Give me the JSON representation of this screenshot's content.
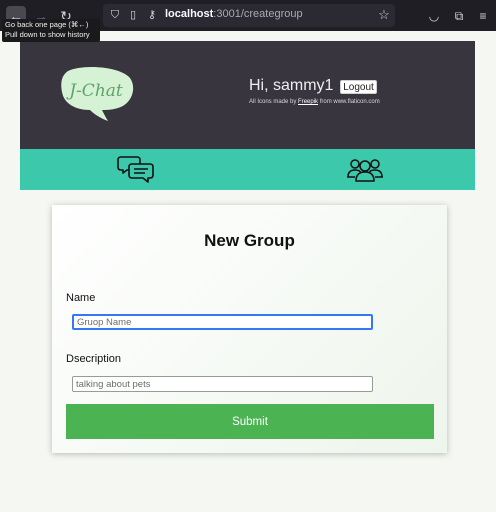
{
  "browser": {
    "url_host": "localhost",
    "url_path": ":3001/creategroup",
    "tooltip_line1": "Go back one page (⌘←)",
    "tooltip_line2": "Pull down to show history"
  },
  "header": {
    "logo_text": "J-Chat",
    "greeting": "Hi, sammy1",
    "logout_label": "Logout",
    "credit_prefix": "All Icons made by ",
    "credit_link": "Freepik",
    "credit_suffix": " from www.flaticon.com"
  },
  "form": {
    "title": "New Group",
    "name_label": "Name",
    "name_placeholder": "Gruop Name",
    "description_label": "Dsecription",
    "description_placeholder": "talking about pets",
    "submit_label": "Submit"
  },
  "colors": {
    "header_bg": "#39353f",
    "iconbar_bg": "#3cc8ab",
    "submit_bg": "#4bb351",
    "focus_ring": "#3478f6"
  }
}
